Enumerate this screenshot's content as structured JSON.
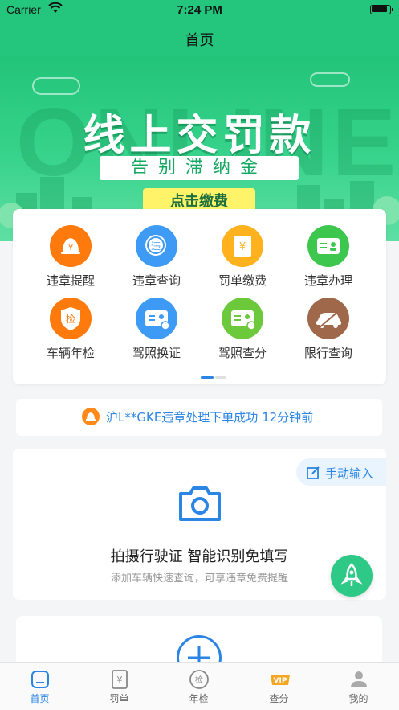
{
  "status_bar": {
    "carrier": "Carrier",
    "time": "7:24 PM"
  },
  "nav": {
    "title": "首页"
  },
  "banner": {
    "ghost_text": "ONLINE",
    "headline": "线上交罚款",
    "subline": "告别滞纳金",
    "pay_button": "点击缴费"
  },
  "menu": {
    "items": [
      {
        "label": "违章提醒",
        "icon": "bell-icon",
        "color": "#ff7a0c"
      },
      {
        "label": "违章查询",
        "icon": "search-violation-icon",
        "color": "#3d9bf5"
      },
      {
        "label": "罚单缴费",
        "icon": "ticket-yuan-icon",
        "color": "#ffb21e"
      },
      {
        "label": "违章办理",
        "icon": "id-card-icon",
        "color": "#3dc74f"
      },
      {
        "label": "车辆年检",
        "icon": "inspection-shield-icon",
        "color": "#ff7a0c"
      },
      {
        "label": "驾照换证",
        "icon": "license-renew-icon",
        "color": "#3d9bf5"
      },
      {
        "label": "驾照查分",
        "icon": "license-score-icon",
        "color": "#6cc93b"
      },
      {
        "label": "限行查询",
        "icon": "car-restriction-icon",
        "color": "#a0684a"
      }
    ]
  },
  "notice": {
    "text": "沪L**GKE违章处理下单成功 12分钟前"
  },
  "scan": {
    "manual_label": "手动输入",
    "title": "拍摄行驶证 智能识别免填写",
    "subtitle": "添加车辆快速查询，可享违章免费提醒"
  },
  "tabs": [
    {
      "label": "首页",
      "icon": "home-icon",
      "active": true
    },
    {
      "label": "罚单",
      "icon": "ticket-icon",
      "active": false
    },
    {
      "label": "年检",
      "icon": "inspection-icon",
      "active": false
    },
    {
      "label": "查分",
      "icon": "vip-icon",
      "active": false
    },
    {
      "label": "我的",
      "icon": "profile-icon",
      "active": false
    }
  ],
  "colors": {
    "primary_green": "#24c57c",
    "accent_blue": "#2b85e4"
  }
}
